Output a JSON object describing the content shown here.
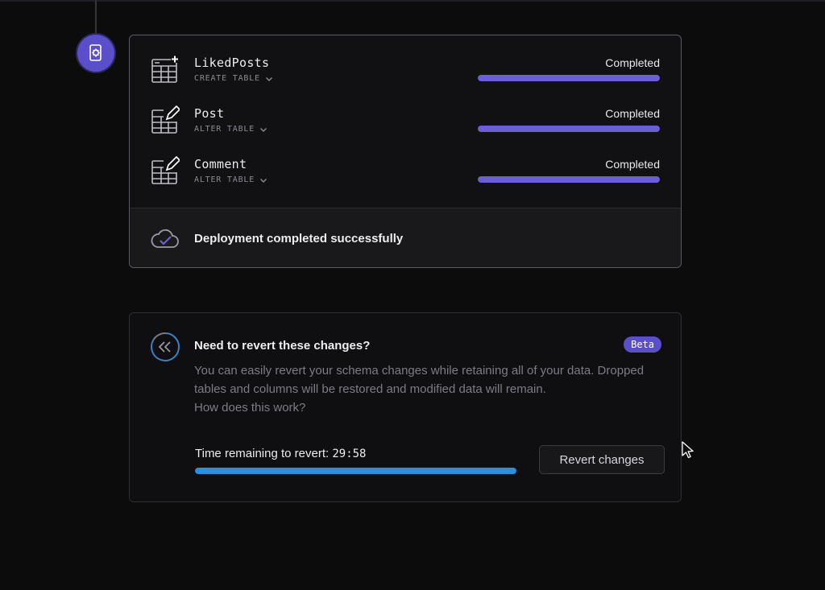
{
  "deployment": {
    "tables": [
      {
        "name": "LikedPosts",
        "action": "CREATE TABLE",
        "status": "Completed",
        "progress": 1.0,
        "icon": "table-create-icon"
      },
      {
        "name": "Post",
        "action": "ALTER TABLE",
        "status": "Completed",
        "progress": 1.0,
        "icon": "table-edit-icon"
      },
      {
        "name": "Comment",
        "action": "ALTER TABLE",
        "status": "Completed",
        "progress": 1.0,
        "icon": "table-edit-icon"
      }
    ],
    "message": "Deployment completed successfully",
    "message_icon": "cloud-check-icon"
  },
  "revert": {
    "title": "Need to revert these changes?",
    "badge": "Beta",
    "description": "You can easily revert your schema changes while retaining all of your data. Dropped tables and columns will be restored and modified data will remain.",
    "link_text": "How does this work?",
    "time_label": "Time remaining to revert:",
    "time_value": "29:58",
    "time_progress": 1.0,
    "button_label": "Revert changes",
    "icon": "rewind-icon"
  },
  "colors": {
    "accent": "#5b4fc9",
    "progress": "#6c5fd6",
    "time_bar": "#2b8fd9",
    "background": "#0c0c0d"
  }
}
